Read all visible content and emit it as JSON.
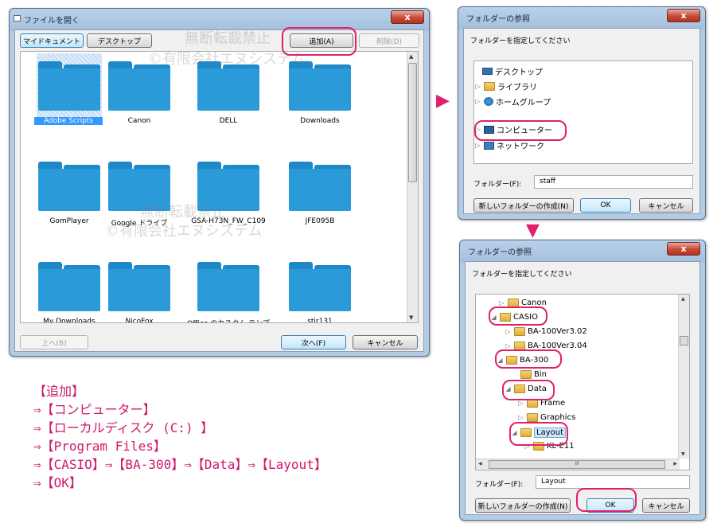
{
  "open_dialog": {
    "title": "ファイルを開く",
    "places": [
      "マイドキュメント",
      "デスクトップ"
    ],
    "add_label": "追加(A)",
    "delete_label": "削除(D)",
    "folders": [
      "Adobe Scripts",
      "Canon",
      "DELL",
      "Downloads",
      "GomPlayer",
      "Google ドライブ",
      "GSA-H73N_FW_C109",
      "JFE095B",
      "My Downloads",
      "NicoFox",
      "Office のカスタム テンプレー",
      "stir131"
    ],
    "up_label": "上へ(B)",
    "next_label": "次へ(F)",
    "cancel_label": "キャンセル",
    "close_glyph": "x"
  },
  "browse_dialog_1": {
    "title": "フォルダーの参照",
    "prompt": "フォルダーを指定してください",
    "tree": [
      "デスクトップ",
      "ライブラリ",
      "ホームグループ",
      "コンピューター",
      "ネットワーク"
    ],
    "folder_label": "フォルダー(F):",
    "folder_value": "staff",
    "new_folder_label": "新しいフォルダーの作成(N)",
    "ok_label": "OK",
    "cancel_label": "キャンセル",
    "close_glyph": "x"
  },
  "browse_dialog_2": {
    "title": "フォルダーの参照",
    "prompt": "フォルダーを指定してください",
    "tree": [
      "Canon",
      "CASIO",
      "BA-100Ver3.02",
      "BA-100Ver3.04",
      "BA-300",
      "Bin",
      "Data",
      "Frame",
      "Graphics",
      "Layout",
      "KL-E11"
    ],
    "scroll_glyph": "III",
    "folder_label": "フォルダー(F):",
    "folder_value": "Layout",
    "new_folder_label": "新しいフォルダーの作成(N)",
    "ok_label": "OK",
    "cancel_label": "キャンセル",
    "close_glyph": "x"
  },
  "watermarks": [
    "無断転載禁止",
    "©有限会社エヌシステム",
    "無断転載禁止",
    "©有限会社エヌシステム"
  ],
  "instructions": [
    "【追加】",
    "⇒【コンピューター】",
    "⇒【ローカルディスク (C:) 】",
    "⇒【Program Files】",
    "⇒【CASIO】⇒【BA-300】⇒【Data】⇒【Layout】",
    "⇒【OK】"
  ],
  "colors": {
    "highlight": "#e0206e",
    "folder": "#2b9ad9",
    "title_bar": "#b9d1ea"
  }
}
